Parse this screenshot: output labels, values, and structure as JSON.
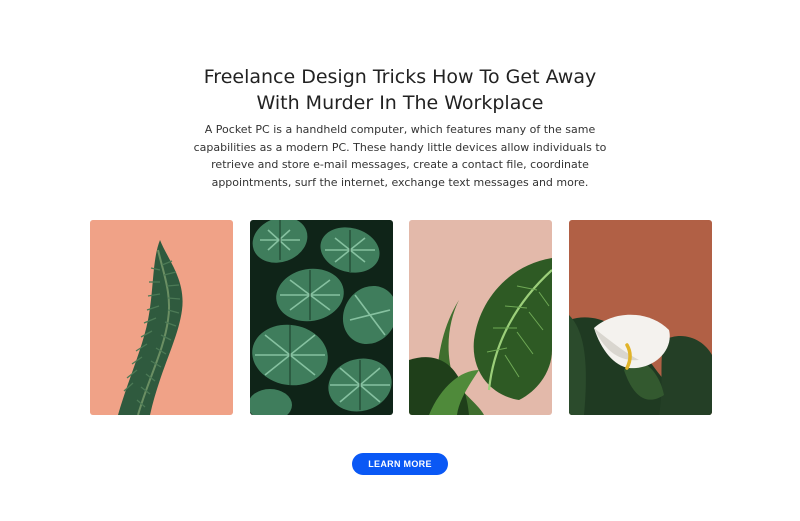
{
  "section": {
    "title_line1": "Freelance Design Tricks How To Get Away",
    "title_line2": "With Murder In The Workplace",
    "description": "A Pocket PC is a handheld computer, which features many of the same capabilities as a modern PC. These handy little devices allow individuals to retrieve and store e-mail messages, create a contact file, coordinate appointments, surf the internet, exchange text messages and more."
  },
  "gallery": {
    "images": [
      {
        "icon": "fern-plant-image",
        "background": "#ee9a7e",
        "foliage": "#2f5a3e"
      },
      {
        "icon": "calathea-leaves-image",
        "background": "#0f2418",
        "foliage": "#6fae8e"
      },
      {
        "icon": "green-leaf-image",
        "background": "#e7c0b2",
        "foliage": "#2e5a24"
      },
      {
        "icon": "calla-lily-image",
        "background": "#b9674a",
        "foliage": "#1f3a22"
      }
    ]
  },
  "cta": {
    "label": "LEARN MORE",
    "color": "#0a58f5"
  }
}
